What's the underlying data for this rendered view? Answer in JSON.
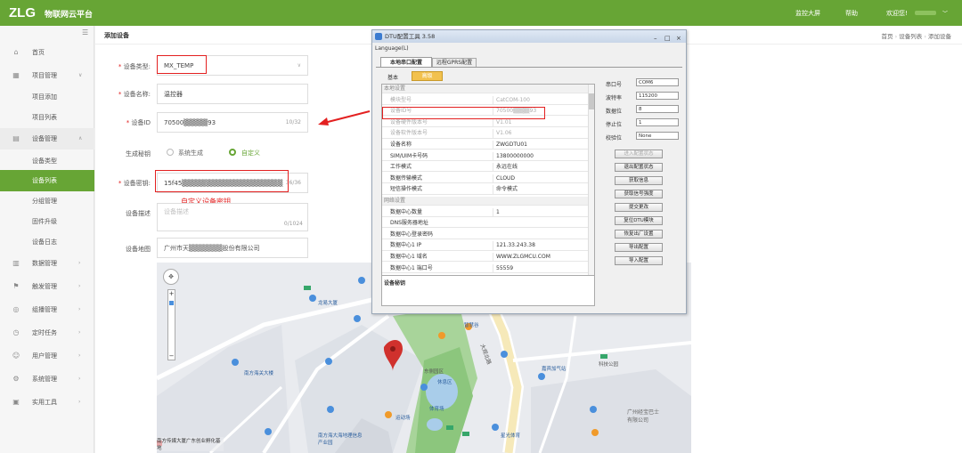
{
  "header": {
    "logo": "ZLG",
    "platform": "物联网云平台",
    "nav": [
      "监控大屏",
      "帮助"
    ],
    "user": "欢迎您!"
  },
  "sidebar": {
    "items": [
      {
        "label": "首页",
        "icon": "home-icon"
      },
      {
        "label": "项目管理",
        "icon": "grid-icon"
      },
      {
        "label": "项目添加"
      },
      {
        "label": "项目列表"
      },
      {
        "label": "设备管理",
        "icon": "list-icon"
      },
      {
        "label": "设备类型"
      },
      {
        "label": "设备列表"
      },
      {
        "label": "分组管理"
      },
      {
        "label": "固件升级"
      },
      {
        "label": "设备日志"
      },
      {
        "label": "数据管理",
        "icon": "chart-icon"
      },
      {
        "label": "触发管理",
        "icon": "trigger-icon"
      },
      {
        "label": "组播管理",
        "icon": "broadcast-icon"
      },
      {
        "label": "定时任务",
        "icon": "timer-icon"
      },
      {
        "label": "用户管理",
        "icon": "user-icon"
      },
      {
        "label": "系统管理",
        "icon": "settings-icon"
      },
      {
        "label": "实用工具",
        "icon": "tools-icon"
      }
    ]
  },
  "page": {
    "title": "添加设备",
    "breadcrumb": [
      "首页",
      "设备列表",
      "添加设备"
    ]
  },
  "form": {
    "device_type_label": "设备类型:",
    "device_type_value": "MX_TEMP",
    "device_name_label": "设备名称:",
    "device_name_value": "温控器",
    "device_id_label": "设备ID",
    "device_id_value": "70500▒▒▒▒▒93",
    "device_id_count": "10/32",
    "gen_secret_label": "生成秘钥",
    "gen_option_system": "系统生成",
    "gen_option_custom": "自定义",
    "device_secret_label": "设备密钥:",
    "device_secret_value": "15f45▒▒▒▒▒▒▒▒▒▒▒▒▒▒▒▒▒▒▒▒▒",
    "device_secret_count": "36/36",
    "device_secret_annotation": "自定义设备密钥",
    "device_desc_label": "设备描述",
    "device_desc_placeholder": "设备描述",
    "device_desc_count": "0/1024",
    "device_address_label": "设备地图",
    "device_address_value": "广州市天▒▒▒▒▒▒▒股份有限公司"
  },
  "map": {
    "labels": [
      "龙易大厦",
      "大观北路",
      "广州经宝巴士有限公司",
      "南方海关大楼",
      "嘉宾加气站",
      "南方传媒大厦广东创业孵化基地",
      "南方海大海地理信息产业园",
      "休息区",
      "东侧园区",
      "科技公园",
      "运动场",
      "体育场",
      "智慧谷",
      "星光体育"
    ]
  },
  "dtu": {
    "title": "DTU配置工具 3.58",
    "language_menu": "Language(L)",
    "tabs": [
      "本地串口配置",
      "远程GPRS配置"
    ],
    "subtabs": [
      "基本",
      "高级"
    ],
    "rows": [
      {
        "k": "本地设置",
        "v": "",
        "type": "section"
      },
      {
        "k": "模块型号",
        "v": "CatCOM-100",
        "type": "disabled"
      },
      {
        "k": "设备ID号",
        "v": "70500▒▒▒▒93",
        "type": "disabled"
      },
      {
        "k": "设备硬件版本号",
        "v": "V1.01",
        "type": "disabled"
      },
      {
        "k": "设备软件版本号",
        "v": "V1.06",
        "type": "disabled"
      },
      {
        "k": "设备名称",
        "v": "ZWGDTU01",
        "type": "normal"
      },
      {
        "k": "SIM/UIM卡号码",
        "v": "13800000000",
        "type": "normal"
      },
      {
        "k": "工作模式",
        "v": "永远在线",
        "type": "normal"
      },
      {
        "k": "数据传输模式",
        "v": "CLOUD",
        "type": "normal"
      },
      {
        "k": "短信操作模式",
        "v": "命令模式",
        "type": "normal"
      },
      {
        "k": "网络设置",
        "v": "",
        "type": "section"
      },
      {
        "k": "数据中心数量",
        "v": "1",
        "type": "normal"
      },
      {
        "k": "DNS服务器地址",
        "v": "",
        "type": "normal"
      },
      {
        "k": "数据中心登录密码",
        "v": "",
        "type": "normal"
      },
      {
        "k": "数据中心1 IP",
        "v": "121.33.243.38",
        "type": "normal"
      },
      {
        "k": "数据中心1 域名",
        "v": "WWW.ZLGMCU.COM",
        "type": "normal"
      },
      {
        "k": "数据中心1 端口号",
        "v": "55559",
        "type": "normal"
      }
    ],
    "desc_label": "设备秘钥",
    "serial": [
      {
        "label": "串口号",
        "value": "COM6"
      },
      {
        "label": "波特率",
        "value": "115200"
      },
      {
        "label": "数据位",
        "value": "8"
      },
      {
        "label": "停止位",
        "value": "1"
      },
      {
        "label": "校验位",
        "value": "None"
      }
    ],
    "buttons": [
      "进入配置状态",
      "退出配置状态",
      "获取信息",
      "获取信号强度",
      "提交更改",
      "复位DTU模块",
      "恢复出厂设置",
      "导出配置",
      "导入配置"
    ]
  },
  "colors": {
    "accent": "#67a535",
    "annotation": "#e32020"
  }
}
